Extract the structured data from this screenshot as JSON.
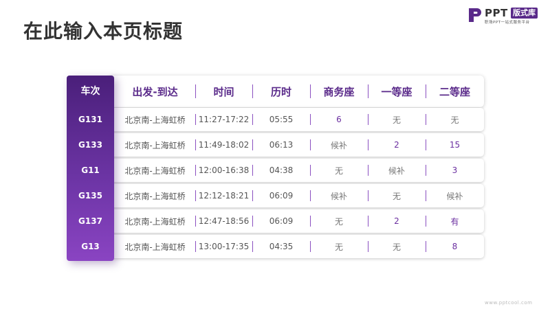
{
  "page": {
    "title": "在此输入本页标题"
  },
  "logo": {
    "brand": "PPT",
    "badge": "版式库",
    "tagline": "职场PPT一站式服务平台",
    "accent_color": "#5a2a8a"
  },
  "table": {
    "header_color": "#5a2a8a",
    "columns": [
      "车次",
      "出发-到达",
      "时间",
      "历时",
      "商务座",
      "一等座",
      "二等座"
    ],
    "rows": [
      {
        "train": "G131",
        "route": "北京南-上海虹桥",
        "time": "11:27-17:22",
        "duration": "05:55",
        "business": "6",
        "first": "无",
        "second": "无"
      },
      {
        "train": "G133",
        "route": "北京南-上海虹桥",
        "time": "11:49-18:02",
        "duration": "06:13",
        "business": "候补",
        "first": "2",
        "second": "15"
      },
      {
        "train": "G11",
        "route": "北京南-上海虹桥",
        "time": "12:00-16:38",
        "duration": "04:38",
        "business": "无",
        "first": "候补",
        "second": "3"
      },
      {
        "train": "G135",
        "route": "北京南-上海虹桥",
        "time": "12:12-18:21",
        "duration": "06:09",
        "business": "候补",
        "first": "无",
        "second": "候补"
      },
      {
        "train": "G137",
        "route": "北京南-上海虹桥",
        "time": "12:47-18:56",
        "duration": "06:09",
        "business": "无",
        "first": "2",
        "second": "有"
      },
      {
        "train": "G13",
        "route": "北京南-上海虹桥",
        "time": "13:00-17:35",
        "duration": "04:35",
        "business": "无",
        "first": "无",
        "second": "8"
      }
    ]
  },
  "watermark": "www.pptcool.com"
}
